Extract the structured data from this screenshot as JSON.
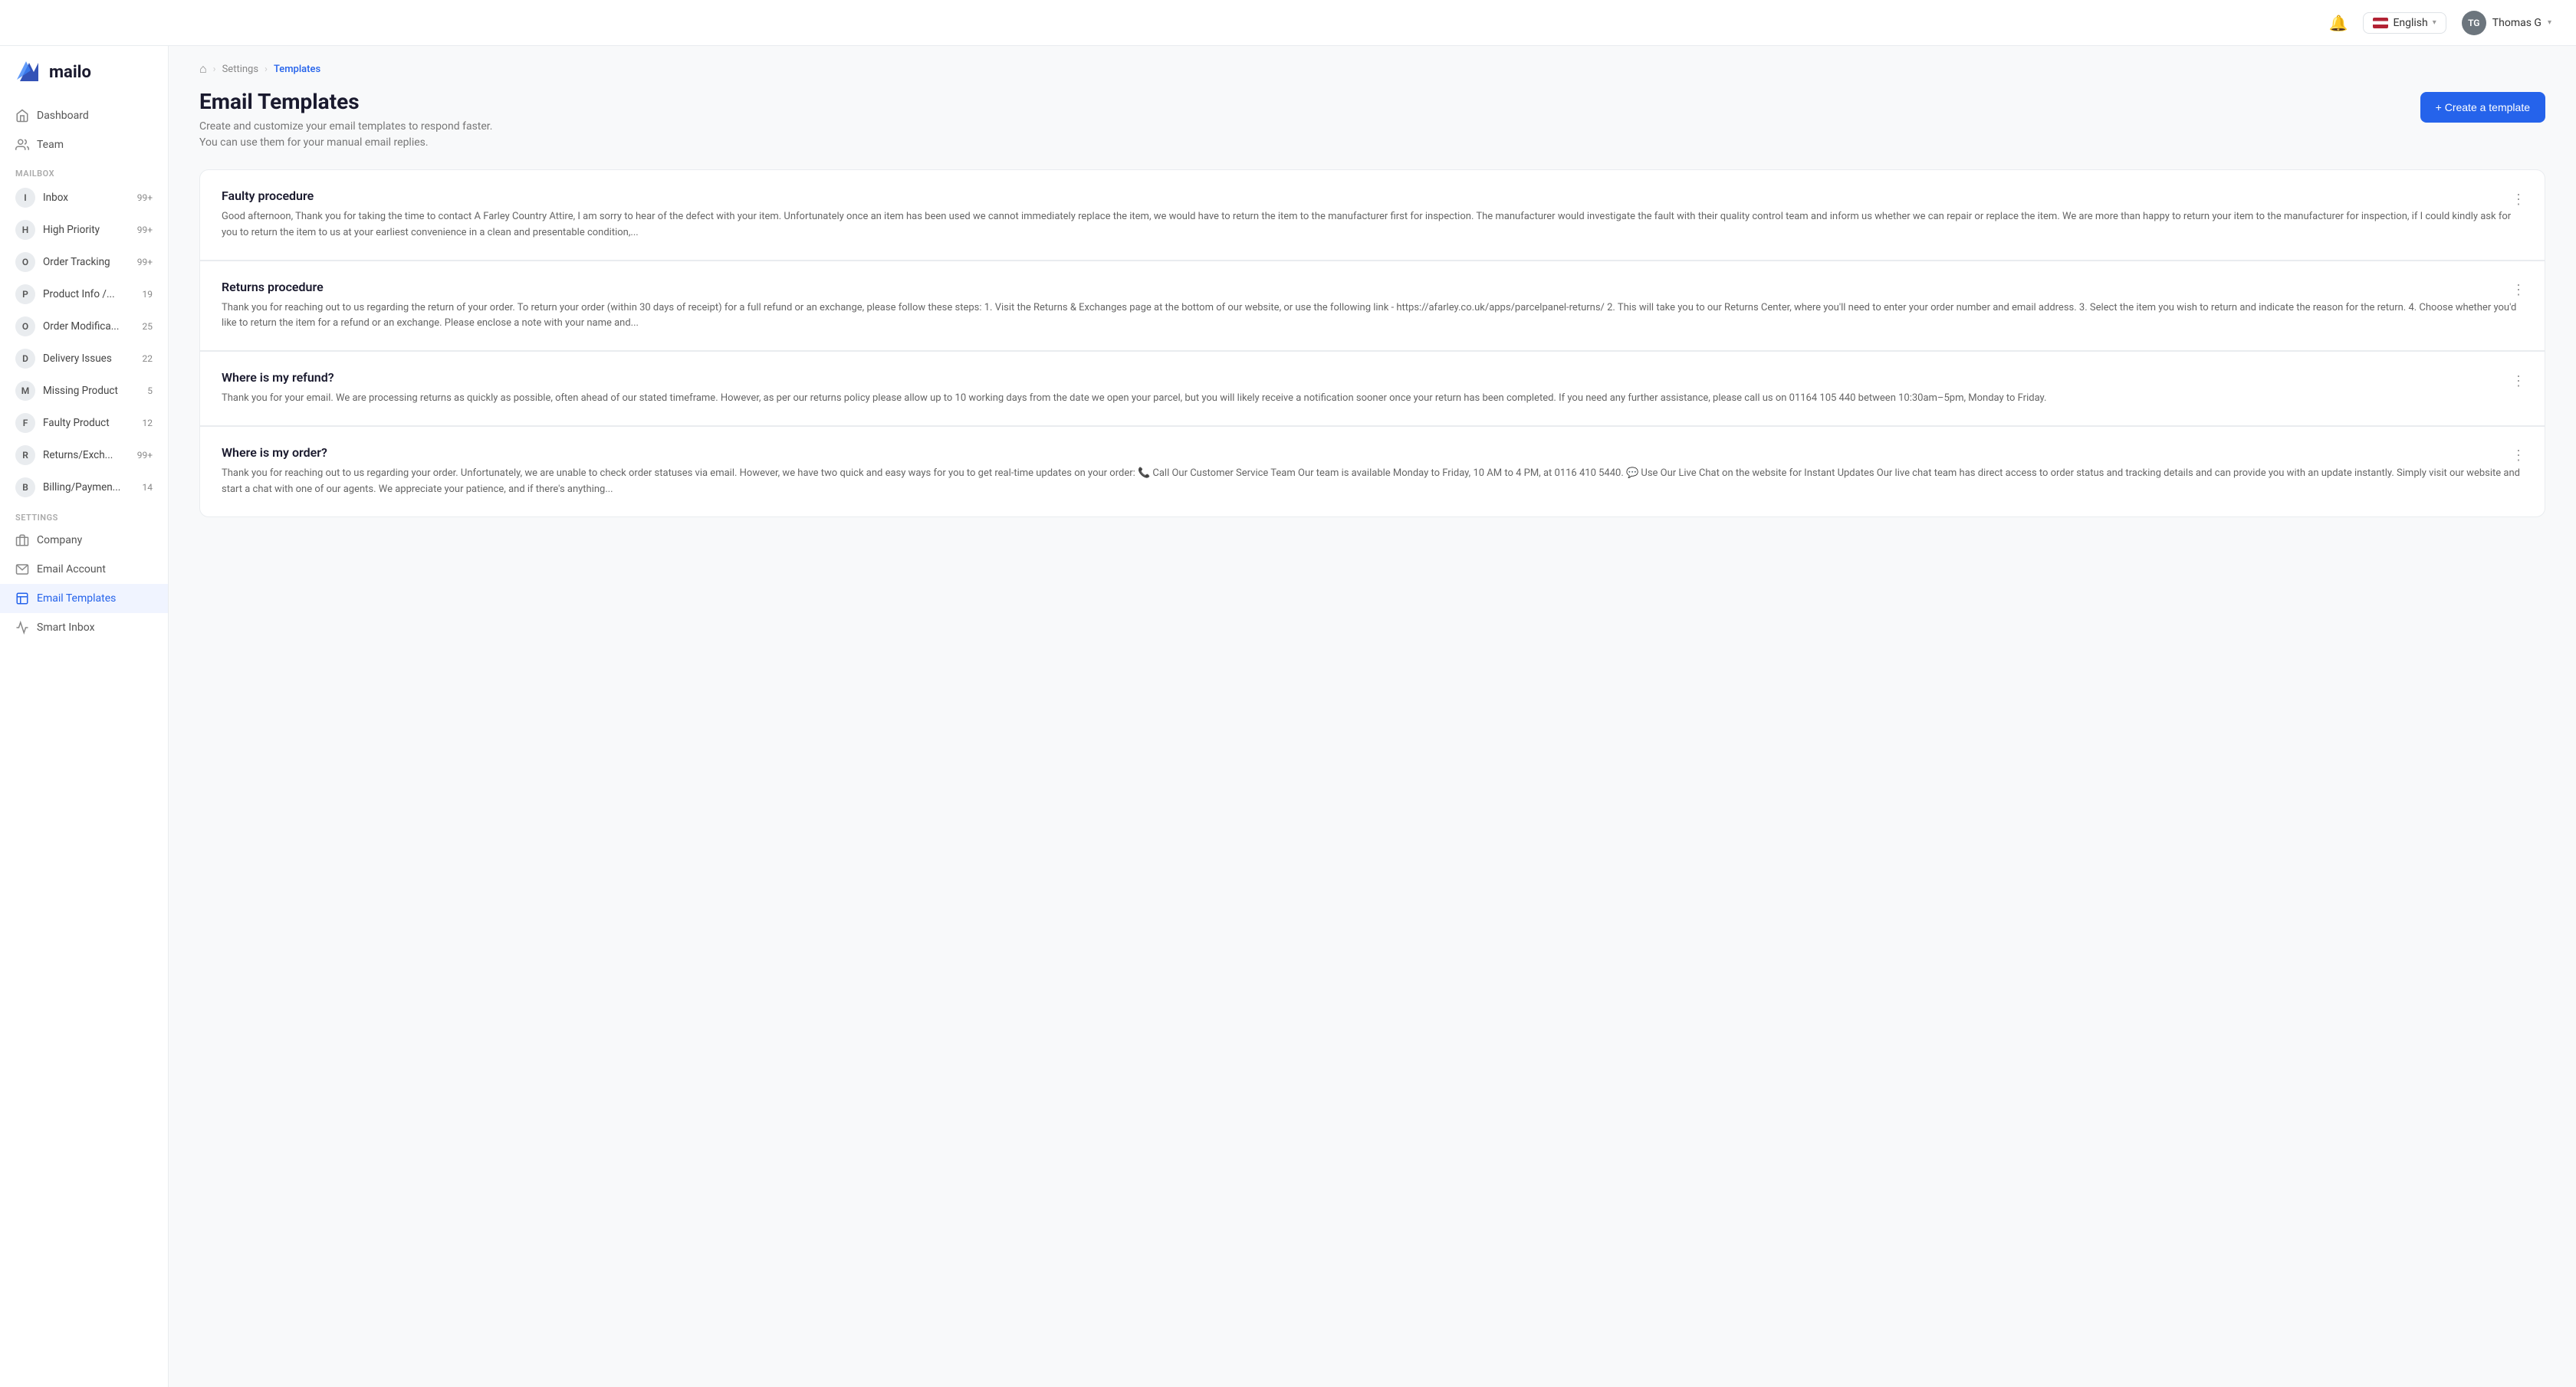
{
  "header": {
    "language": "English",
    "user": {
      "name": "Thomas G",
      "initials": "TG"
    }
  },
  "sidebar": {
    "logo_text": "mailo",
    "nav_items": [
      {
        "id": "dashboard",
        "label": "Dashboard",
        "icon": "home"
      },
      {
        "id": "team",
        "label": "Team",
        "icon": "users"
      }
    ],
    "mailbox_section_label": "Mailbox",
    "mailbox_items": [
      {
        "id": "inbox",
        "label": "Inbox",
        "initial": "I",
        "count": "99+"
      },
      {
        "id": "high-priority",
        "label": "High Priority",
        "initial": "H",
        "count": "99+"
      },
      {
        "id": "order-tracking",
        "label": "Order Tracking",
        "initial": "O",
        "count": "99+"
      },
      {
        "id": "product-info",
        "label": "Product Info /...",
        "initial": "P",
        "count": "19"
      },
      {
        "id": "order-modifications",
        "label": "Order Modifica...",
        "initial": "O",
        "count": "25"
      },
      {
        "id": "delivery-issues",
        "label": "Delivery Issues",
        "initial": "D",
        "count": "22"
      },
      {
        "id": "missing-product",
        "label": "Missing Product",
        "initial": "M",
        "count": "5"
      },
      {
        "id": "faulty-product",
        "label": "Faulty Product",
        "initial": "F",
        "count": "12"
      },
      {
        "id": "returns-exchange",
        "label": "Returns/Exch...",
        "initial": "R",
        "count": "99+"
      },
      {
        "id": "billing-payments",
        "label": "Billing/Paymen...",
        "initial": "B",
        "count": "14"
      }
    ],
    "settings_section_label": "Settings",
    "settings_items": [
      {
        "id": "company",
        "label": "Company",
        "icon": "building"
      },
      {
        "id": "email-account",
        "label": "Email Account",
        "icon": "envelope"
      },
      {
        "id": "email-templates",
        "label": "Email Templates",
        "icon": "template",
        "active": true
      },
      {
        "id": "smart-inbox",
        "label": "Smart Inbox",
        "icon": "smart"
      }
    ]
  },
  "breadcrumb": {
    "home_icon": "🏠",
    "items": [
      {
        "label": "Settings",
        "active": false
      },
      {
        "label": "Templates",
        "active": true
      }
    ]
  },
  "page": {
    "title": "Email Templates",
    "subtitle_line1": "Create and customize your email templates to respond faster.",
    "subtitle_line2": "You can use them for your manual email replies.",
    "create_button": "+ Create a template"
  },
  "templates": [
    {
      "id": "faulty-procedure",
      "title": "Faulty procedure",
      "body": "Good afternoon, Thank you for taking the time to contact A Farley Country Attire, I am sorry to hear of the defect with your item. Unfortunately once an item has been used we cannot immediately replace the item, we would have to return the item to the manufacturer first for inspection. The manufacturer would investigate the fault with their quality control team and inform us whether we can repair or replace the item. We are more than happy to return your item to the manufacturer for inspection, if I could kindly ask for you to return the item to us at your earliest convenience in a clean and presentable condition,..."
    },
    {
      "id": "returns-procedure",
      "title": "Returns procedure",
      "body": "Thank you for reaching out to us regarding the return of your order. To return your order (within 30 days of receipt) for a full refund or an exchange, please follow these steps: 1. Visit the Returns & Exchanges page at the bottom of our website, or use the following link - https://afarley.co.uk/apps/parcelpanel-returns/ 2. This will take you to our Returns Center, where you'll need to enter your order number and email address. 3. Select the item you wish to return and indicate the reason for the return. 4. Choose whether you'd like to return the item for a refund or an exchange. Please enclose a note with your name and..."
    },
    {
      "id": "where-is-my-refund",
      "title": "Where is my refund?",
      "body": "Thank you for your email. We are processing returns as quickly as possible, often ahead of our stated timeframe. However, as per our returns policy please allow up to 10 working days from the date we open your parcel, but you will likely receive a notification sooner once your return has been completed. If you need any further assistance, please call us on 01164 105 440 between 10:30am–5pm, Monday to Friday."
    },
    {
      "id": "where-is-my-order",
      "title": "Where is my order?",
      "body": "Thank you for reaching out to us regarding your order. Unfortunately, we are unable to check order statuses via email. However, we have two quick and easy ways for you to get real-time updates on your order: 📞 Call Our Customer Service Team Our team is available Monday to Friday, 10 AM to 4 PM, at 0116 410 5440. 💬 Use Our Live Chat on the website for Instant Updates Our live chat team has direct access to order status and tracking details and can provide you with an update instantly. Simply visit our website and start a chat with one of our agents. We appreciate your patience, and if there's anything..."
    }
  ]
}
